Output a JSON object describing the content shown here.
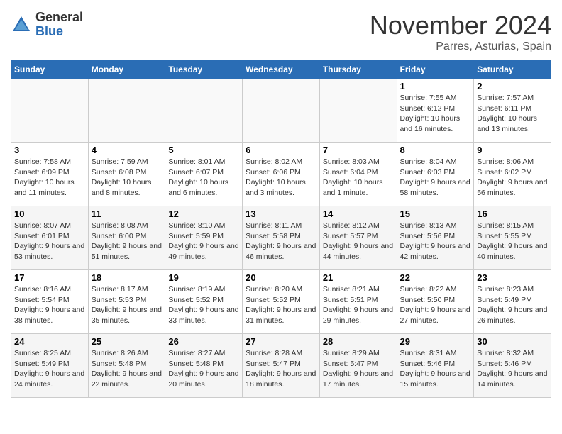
{
  "header": {
    "logo_general": "General",
    "logo_blue": "Blue",
    "month_title": "November 2024",
    "location": "Parres, Asturias, Spain"
  },
  "weekdays": [
    "Sunday",
    "Monday",
    "Tuesday",
    "Wednesday",
    "Thursday",
    "Friday",
    "Saturday"
  ],
  "weeks": [
    [
      {
        "day": "",
        "info": ""
      },
      {
        "day": "",
        "info": ""
      },
      {
        "day": "",
        "info": ""
      },
      {
        "day": "",
        "info": ""
      },
      {
        "day": "",
        "info": ""
      },
      {
        "day": "1",
        "info": "Sunrise: 7:55 AM\nSunset: 6:12 PM\nDaylight: 10 hours and 16 minutes."
      },
      {
        "day": "2",
        "info": "Sunrise: 7:57 AM\nSunset: 6:11 PM\nDaylight: 10 hours and 13 minutes."
      }
    ],
    [
      {
        "day": "3",
        "info": "Sunrise: 7:58 AM\nSunset: 6:09 PM\nDaylight: 10 hours and 11 minutes."
      },
      {
        "day": "4",
        "info": "Sunrise: 7:59 AM\nSunset: 6:08 PM\nDaylight: 10 hours and 8 minutes."
      },
      {
        "day": "5",
        "info": "Sunrise: 8:01 AM\nSunset: 6:07 PM\nDaylight: 10 hours and 6 minutes."
      },
      {
        "day": "6",
        "info": "Sunrise: 8:02 AM\nSunset: 6:06 PM\nDaylight: 10 hours and 3 minutes."
      },
      {
        "day": "7",
        "info": "Sunrise: 8:03 AM\nSunset: 6:04 PM\nDaylight: 10 hours and 1 minute."
      },
      {
        "day": "8",
        "info": "Sunrise: 8:04 AM\nSunset: 6:03 PM\nDaylight: 9 hours and 58 minutes."
      },
      {
        "day": "9",
        "info": "Sunrise: 8:06 AM\nSunset: 6:02 PM\nDaylight: 9 hours and 56 minutes."
      }
    ],
    [
      {
        "day": "10",
        "info": "Sunrise: 8:07 AM\nSunset: 6:01 PM\nDaylight: 9 hours and 53 minutes."
      },
      {
        "day": "11",
        "info": "Sunrise: 8:08 AM\nSunset: 6:00 PM\nDaylight: 9 hours and 51 minutes."
      },
      {
        "day": "12",
        "info": "Sunrise: 8:10 AM\nSunset: 5:59 PM\nDaylight: 9 hours and 49 minutes."
      },
      {
        "day": "13",
        "info": "Sunrise: 8:11 AM\nSunset: 5:58 PM\nDaylight: 9 hours and 46 minutes."
      },
      {
        "day": "14",
        "info": "Sunrise: 8:12 AM\nSunset: 5:57 PM\nDaylight: 9 hours and 44 minutes."
      },
      {
        "day": "15",
        "info": "Sunrise: 8:13 AM\nSunset: 5:56 PM\nDaylight: 9 hours and 42 minutes."
      },
      {
        "day": "16",
        "info": "Sunrise: 8:15 AM\nSunset: 5:55 PM\nDaylight: 9 hours and 40 minutes."
      }
    ],
    [
      {
        "day": "17",
        "info": "Sunrise: 8:16 AM\nSunset: 5:54 PM\nDaylight: 9 hours and 38 minutes."
      },
      {
        "day": "18",
        "info": "Sunrise: 8:17 AM\nSunset: 5:53 PM\nDaylight: 9 hours and 35 minutes."
      },
      {
        "day": "19",
        "info": "Sunrise: 8:19 AM\nSunset: 5:52 PM\nDaylight: 9 hours and 33 minutes."
      },
      {
        "day": "20",
        "info": "Sunrise: 8:20 AM\nSunset: 5:52 PM\nDaylight: 9 hours and 31 minutes."
      },
      {
        "day": "21",
        "info": "Sunrise: 8:21 AM\nSunset: 5:51 PM\nDaylight: 9 hours and 29 minutes."
      },
      {
        "day": "22",
        "info": "Sunrise: 8:22 AM\nSunset: 5:50 PM\nDaylight: 9 hours and 27 minutes."
      },
      {
        "day": "23",
        "info": "Sunrise: 8:23 AM\nSunset: 5:49 PM\nDaylight: 9 hours and 26 minutes."
      }
    ],
    [
      {
        "day": "24",
        "info": "Sunrise: 8:25 AM\nSunset: 5:49 PM\nDaylight: 9 hours and 24 minutes."
      },
      {
        "day": "25",
        "info": "Sunrise: 8:26 AM\nSunset: 5:48 PM\nDaylight: 9 hours and 22 minutes."
      },
      {
        "day": "26",
        "info": "Sunrise: 8:27 AM\nSunset: 5:48 PM\nDaylight: 9 hours and 20 minutes."
      },
      {
        "day": "27",
        "info": "Sunrise: 8:28 AM\nSunset: 5:47 PM\nDaylight: 9 hours and 18 minutes."
      },
      {
        "day": "28",
        "info": "Sunrise: 8:29 AM\nSunset: 5:47 PM\nDaylight: 9 hours and 17 minutes."
      },
      {
        "day": "29",
        "info": "Sunrise: 8:31 AM\nSunset: 5:46 PM\nDaylight: 9 hours and 15 minutes."
      },
      {
        "day": "30",
        "info": "Sunrise: 8:32 AM\nSunset: 5:46 PM\nDaylight: 9 hours and 14 minutes."
      }
    ]
  ]
}
